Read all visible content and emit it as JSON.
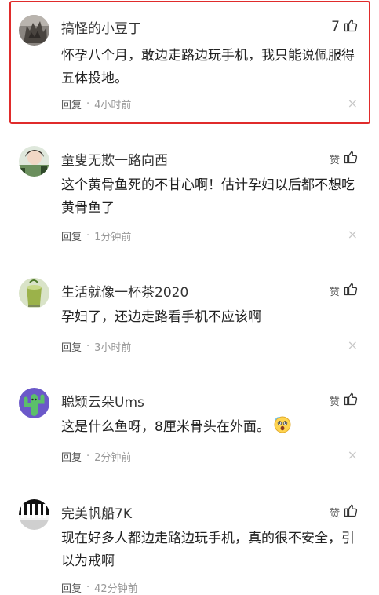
{
  "comments": [
    {
      "username": "搞怪的小豆丁",
      "like_label": "7",
      "text": "怀孕八个月，敢边走路边玩手机，我只能说佩服得五体投地。",
      "reply_label": "回复",
      "separator": "·",
      "time": "4小时前",
      "close_glyph": "×"
    },
    {
      "username": "童叟无欺一路向西",
      "like_label": "赞",
      "text": "这个黄骨鱼死的不甘心啊！估计孕妇以后都不想吃黄骨鱼了",
      "reply_label": "回复",
      "separator": "·",
      "time": "1分钟前",
      "close_glyph": "×"
    },
    {
      "username": "生活就像一杯茶2020",
      "like_label": "赞",
      "text": "孕妇了，还边走路看手机不应该啊",
      "reply_label": "回复",
      "separator": "·",
      "time": "3小时前",
      "close_glyph": "×"
    },
    {
      "username": "聪颖云朵Ums",
      "like_label": "赞",
      "text": "这是什么鱼呀，8厘米骨头在外面。",
      "reply_label": "回复",
      "separator": "·",
      "time": "2分钟前",
      "close_glyph": "×",
      "emoji_icon": "scared-emoji-icon"
    },
    {
      "username": "完美帆船7K",
      "like_label": "赞",
      "text": "现在好多人都边走路边玩手机，真的很不安全，引以为戒啊",
      "reply_label": "回复",
      "separator": "·",
      "time": "42分钟前",
      "close_glyph": "×"
    }
  ],
  "colors": {
    "highlight_border": "#e02b2b",
    "meta_text": "#999999",
    "avatar_cactus": "#5bbf6a",
    "avatar_cactus_bg": "#6b58c9"
  },
  "icons": {
    "like": "thumbs-up-icon",
    "close": "close-icon"
  }
}
